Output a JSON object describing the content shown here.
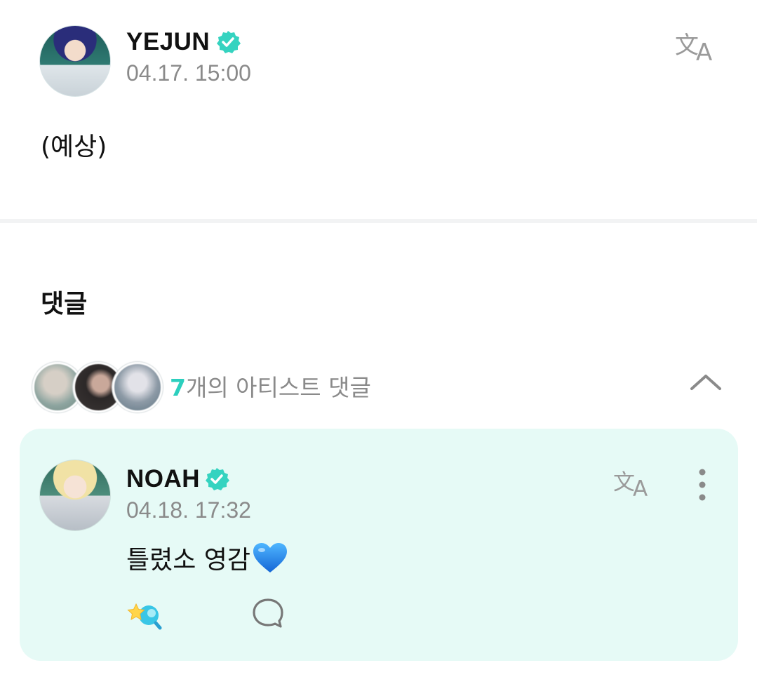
{
  "post": {
    "author": "YEJUN",
    "time": "04.17. 15:00",
    "body": "(예상)"
  },
  "comments": {
    "title": "댓글",
    "artist_count": "7",
    "artist_count_suffix": "개의 아티스트 댓글"
  },
  "comment": {
    "author": "NOAH",
    "time": "04.18. 17:32",
    "text": "틀렸소 영감"
  },
  "icons": {
    "verified": "verified-check-icon",
    "translate": "translate-icon",
    "collapse": "chevron-up-icon",
    "more": "more-vertical-icon",
    "reaction": "star-reaction-icon",
    "reply": "reply-bubble-icon",
    "heart": "blue-heart-emoji"
  },
  "colors": {
    "accent": "#2ccfbe",
    "card_bg": "#e6faf6",
    "verified": "#35d3c0",
    "muted": "#8a8a8a"
  }
}
